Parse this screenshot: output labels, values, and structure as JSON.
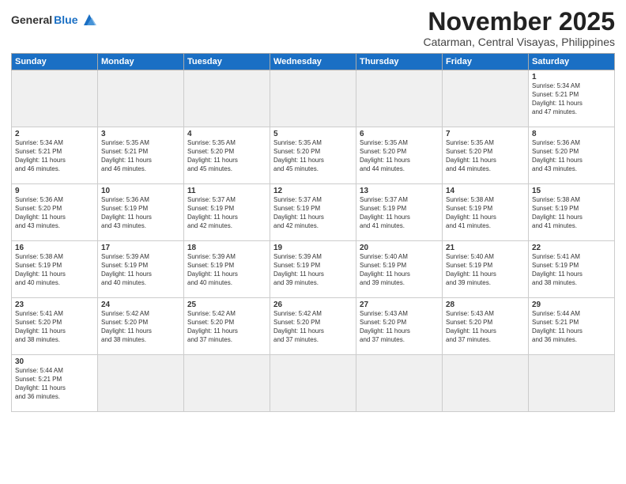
{
  "header": {
    "logo_general": "General",
    "logo_blue": "Blue",
    "month_title": "November 2025",
    "location": "Catarman, Central Visayas, Philippines"
  },
  "weekdays": [
    "Sunday",
    "Monday",
    "Tuesday",
    "Wednesday",
    "Thursday",
    "Friday",
    "Saturday"
  ],
  "days": [
    {
      "date": "",
      "content": ""
    },
    {
      "date": "",
      "content": ""
    },
    {
      "date": "",
      "content": ""
    },
    {
      "date": "",
      "content": ""
    },
    {
      "date": "",
      "content": ""
    },
    {
      "date": "",
      "content": ""
    },
    {
      "date": "1",
      "content": "Sunrise: 5:34 AM\nSunset: 5:21 PM\nDaylight: 11 hours\nand 47 minutes."
    },
    {
      "date": "2",
      "content": "Sunrise: 5:34 AM\nSunset: 5:21 PM\nDaylight: 11 hours\nand 46 minutes."
    },
    {
      "date": "3",
      "content": "Sunrise: 5:35 AM\nSunset: 5:21 PM\nDaylight: 11 hours\nand 46 minutes."
    },
    {
      "date": "4",
      "content": "Sunrise: 5:35 AM\nSunset: 5:20 PM\nDaylight: 11 hours\nand 45 minutes."
    },
    {
      "date": "5",
      "content": "Sunrise: 5:35 AM\nSunset: 5:20 PM\nDaylight: 11 hours\nand 45 minutes."
    },
    {
      "date": "6",
      "content": "Sunrise: 5:35 AM\nSunset: 5:20 PM\nDaylight: 11 hours\nand 44 minutes."
    },
    {
      "date": "7",
      "content": "Sunrise: 5:35 AM\nSunset: 5:20 PM\nDaylight: 11 hours\nand 44 minutes."
    },
    {
      "date": "8",
      "content": "Sunrise: 5:36 AM\nSunset: 5:20 PM\nDaylight: 11 hours\nand 43 minutes."
    },
    {
      "date": "9",
      "content": "Sunrise: 5:36 AM\nSunset: 5:20 PM\nDaylight: 11 hours\nand 43 minutes."
    },
    {
      "date": "10",
      "content": "Sunrise: 5:36 AM\nSunset: 5:19 PM\nDaylight: 11 hours\nand 43 minutes."
    },
    {
      "date": "11",
      "content": "Sunrise: 5:37 AM\nSunset: 5:19 PM\nDaylight: 11 hours\nand 42 minutes."
    },
    {
      "date": "12",
      "content": "Sunrise: 5:37 AM\nSunset: 5:19 PM\nDaylight: 11 hours\nand 42 minutes."
    },
    {
      "date": "13",
      "content": "Sunrise: 5:37 AM\nSunset: 5:19 PM\nDaylight: 11 hours\nand 41 minutes."
    },
    {
      "date": "14",
      "content": "Sunrise: 5:38 AM\nSunset: 5:19 PM\nDaylight: 11 hours\nand 41 minutes."
    },
    {
      "date": "15",
      "content": "Sunrise: 5:38 AM\nSunset: 5:19 PM\nDaylight: 11 hours\nand 41 minutes."
    },
    {
      "date": "16",
      "content": "Sunrise: 5:38 AM\nSunset: 5:19 PM\nDaylight: 11 hours\nand 40 minutes."
    },
    {
      "date": "17",
      "content": "Sunrise: 5:39 AM\nSunset: 5:19 PM\nDaylight: 11 hours\nand 40 minutes."
    },
    {
      "date": "18",
      "content": "Sunrise: 5:39 AM\nSunset: 5:19 PM\nDaylight: 11 hours\nand 40 minutes."
    },
    {
      "date": "19",
      "content": "Sunrise: 5:39 AM\nSunset: 5:19 PM\nDaylight: 11 hours\nand 39 minutes."
    },
    {
      "date": "20",
      "content": "Sunrise: 5:40 AM\nSunset: 5:19 PM\nDaylight: 11 hours\nand 39 minutes."
    },
    {
      "date": "21",
      "content": "Sunrise: 5:40 AM\nSunset: 5:19 PM\nDaylight: 11 hours\nand 39 minutes."
    },
    {
      "date": "22",
      "content": "Sunrise: 5:41 AM\nSunset: 5:19 PM\nDaylight: 11 hours\nand 38 minutes."
    },
    {
      "date": "23",
      "content": "Sunrise: 5:41 AM\nSunset: 5:20 PM\nDaylight: 11 hours\nand 38 minutes."
    },
    {
      "date": "24",
      "content": "Sunrise: 5:42 AM\nSunset: 5:20 PM\nDaylight: 11 hours\nand 38 minutes."
    },
    {
      "date": "25",
      "content": "Sunrise: 5:42 AM\nSunset: 5:20 PM\nDaylight: 11 hours\nand 37 minutes."
    },
    {
      "date": "26",
      "content": "Sunrise: 5:42 AM\nSunset: 5:20 PM\nDaylight: 11 hours\nand 37 minutes."
    },
    {
      "date": "27",
      "content": "Sunrise: 5:43 AM\nSunset: 5:20 PM\nDaylight: 11 hours\nand 37 minutes."
    },
    {
      "date": "28",
      "content": "Sunrise: 5:43 AM\nSunset: 5:20 PM\nDaylight: 11 hours\nand 37 minutes."
    },
    {
      "date": "29",
      "content": "Sunrise: 5:44 AM\nSunset: 5:21 PM\nDaylight: 11 hours\nand 36 minutes."
    },
    {
      "date": "30",
      "content": "Sunrise: 5:44 AM\nSunset: 5:21 PM\nDaylight: 11 hours\nand 36 minutes."
    },
    {
      "date": "",
      "content": ""
    },
    {
      "date": "",
      "content": ""
    },
    {
      "date": "",
      "content": ""
    },
    {
      "date": "",
      "content": ""
    },
    {
      "date": "",
      "content": ""
    },
    {
      "date": "",
      "content": ""
    }
  ]
}
